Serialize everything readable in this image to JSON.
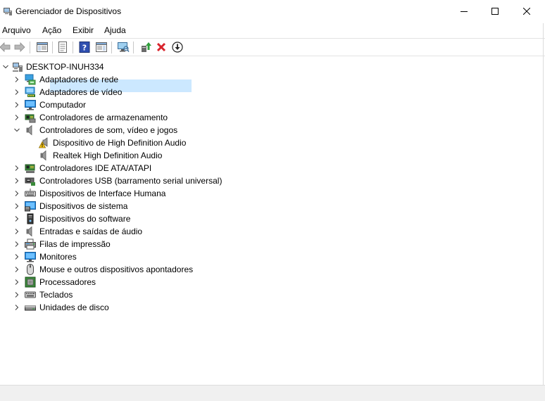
{
  "window": {
    "title": "Gerenciador de Dispositivos"
  },
  "menu": [
    "Arquivo",
    "Ação",
    "Exibir",
    "Ajuda"
  ],
  "tree": {
    "root": "DESKTOP-INUH334",
    "categories": [
      {
        "label": "Adaptadores de rede",
        "icon": "network-adapter-icon"
      },
      {
        "label": "Adaptadores de vídeo",
        "icon": "display-adapter-icon"
      },
      {
        "label": "Computador",
        "icon": "computer-icon"
      },
      {
        "label": "Controladores de armazenamento",
        "icon": "storage-controller-icon"
      },
      {
        "label": "Controladores de som, vídeo e jogos",
        "icon": "speaker-icon",
        "expanded": true,
        "children": [
          {
            "label": "Dispositivo de High Definition Audio",
            "icon": "warning-speaker-icon",
            "selected": true
          },
          {
            "label": "Realtek High Definition Audio",
            "icon": "speaker-icon"
          }
        ]
      },
      {
        "label": "Controladores IDE ATA/ATAPI",
        "icon": "ide-controller-icon"
      },
      {
        "label": "Controladores USB (barramento serial universal)",
        "icon": "usb-controller-icon"
      },
      {
        "label": "Dispositivos de Interface Humana",
        "icon": "hid-icon"
      },
      {
        "label": "Dispositivos de sistema",
        "icon": "system-device-icon"
      },
      {
        "label": "Dispositivos do software",
        "icon": "software-device-icon"
      },
      {
        "label": "Entradas e saídas de áudio",
        "icon": "audio-io-icon"
      },
      {
        "label": "Filas de impressão",
        "icon": "printer-icon"
      },
      {
        "label": "Monitores",
        "icon": "monitor-icon"
      },
      {
        "label": "Mouse e outros dispositivos apontadores",
        "icon": "mouse-icon"
      },
      {
        "label": "Processadores",
        "icon": "processor-icon"
      },
      {
        "label": "Teclados",
        "icon": "keyboard-icon"
      },
      {
        "label": "Unidades de disco",
        "icon": "disk-drive-icon"
      }
    ]
  },
  "colors": {
    "selection": "#cce8ff",
    "accent_blue": "#1a73c8",
    "warning": "#f5c518",
    "remove_red": "#d8242c",
    "enable_green": "#2e9e3a"
  }
}
